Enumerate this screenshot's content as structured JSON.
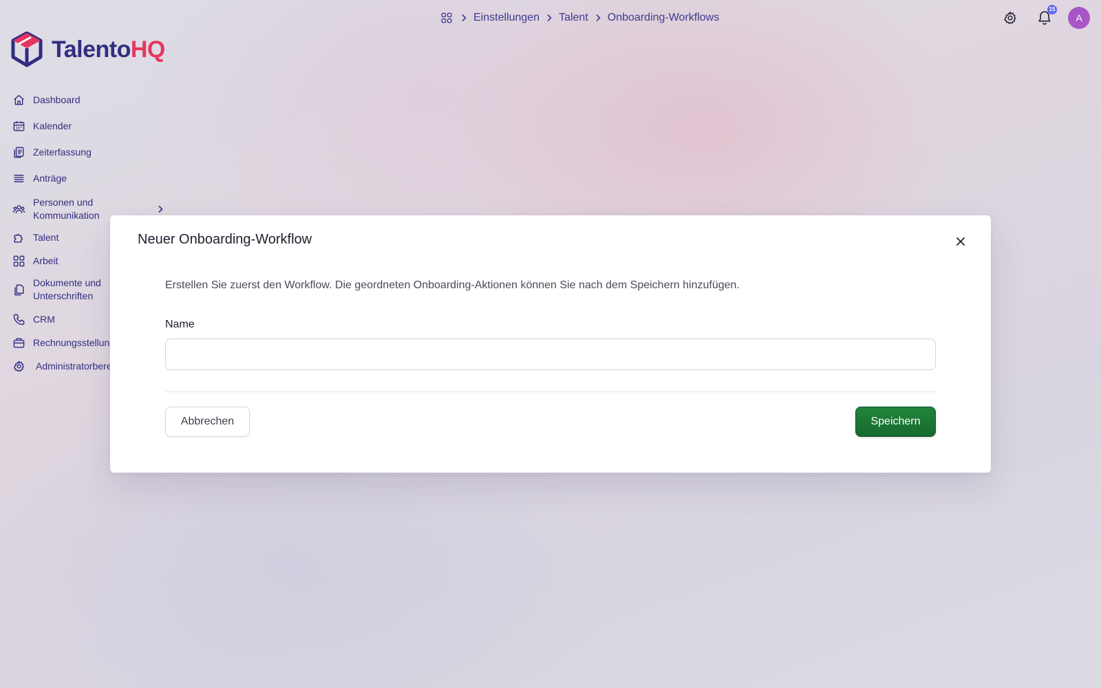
{
  "app": {
    "logo_text_primary": "Talento",
    "logo_text_accent": "HQ"
  },
  "breadcrumb": {
    "home_icon": "apps-grid-icon",
    "items": [
      "Einstellungen",
      "Talent",
      "Onboarding-Workflows"
    ]
  },
  "header": {
    "settings_icon": "gear-icon",
    "notifications_icon": "bell-icon",
    "notification_count": "15",
    "avatar_initial": "A"
  },
  "sidebar": {
    "items": [
      {
        "label": "Dashboard",
        "icon": "home-icon"
      },
      {
        "label": "Kalender",
        "icon": "calendar-icon"
      },
      {
        "label": "Zeiterfassung",
        "icon": "clipboard-icon"
      },
      {
        "label": "Anträge",
        "icon": "list-stack-icon"
      },
      {
        "label": "Personen und Kommunikation",
        "icon": "people-icon",
        "expandable": true
      },
      {
        "label": "Talent",
        "icon": "puzzle-icon"
      },
      {
        "label": "Arbeit",
        "icon": "grid-icon"
      },
      {
        "label": "Dokumente und Unterschriften",
        "icon": "documents-icon"
      },
      {
        "label": "CRM",
        "icon": "phone-icon"
      },
      {
        "label": "Rechnungsstellung",
        "icon": "briefcase-icon"
      },
      {
        "label": "Administratorbereich",
        "icon": "gear-icon"
      }
    ]
  },
  "modal": {
    "title": "Neuer Onboarding-Workflow",
    "description": "Erstellen Sie zuerst den Workflow. Die geordneten Onboarding-Aktionen können Sie nach dem Speichern hinzufügen.",
    "name_label": "Name",
    "name_value": "",
    "cancel_label": "Abbrechen",
    "save_label": "Speichern"
  },
  "colors": {
    "brand_primary": "#312e81",
    "brand_accent": "#e5365f",
    "save_button": "#1a7a34",
    "avatar": "#a855c7",
    "badge": "#6366f1"
  }
}
